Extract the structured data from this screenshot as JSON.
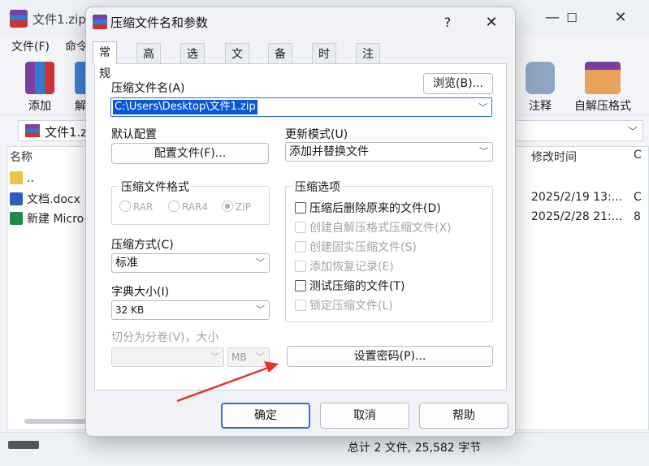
{
  "background": {
    "window_title": "文件1.zip",
    "menus": [
      "文件(F)",
      "命令"
    ],
    "toolbar": [
      {
        "label": "添加",
        "icon": "winrar-books-icon"
      },
      {
        "label": "解",
        "icon": "extract-icon"
      },
      {
        "label": "注释",
        "icon": "comment-icon"
      },
      {
        "label": "自解压格式",
        "icon": "sfx-box-icon"
      }
    ],
    "address": "文件1.zi",
    "columns": {
      "name": "名称",
      "modified": "修改时间",
      "c": "C"
    },
    "rows": [
      {
        "name": "..",
        "modified": "",
        "c": ""
      },
      {
        "name": "文档.docx",
        "modified": "2025/2/19 13:...",
        "c": "C"
      },
      {
        "name": "新建 Micro",
        "modified": "2025/2/28 21:...",
        "c": "8"
      }
    ],
    "status": "总计 2 文件, 25,582 字节"
  },
  "dialog": {
    "title": "压缩文件名和参数",
    "help": "?",
    "close": "✕",
    "tabs": [
      "常规",
      "高级",
      "选项",
      "文件",
      "备份",
      "时间",
      "注释"
    ],
    "archive_name_label": "压缩文件名(A)",
    "browse_button": "浏览(B)...",
    "archive_path": "C:\\Users\\Desktop\\文件1.zip",
    "default_profile_label": "默认配置",
    "profile_button": "配置文件(F)...",
    "update_mode_label": "更新模式(U)",
    "update_mode_value": "添加并替换文件",
    "format_group_title": "压缩文件格式",
    "formats": [
      "RAR",
      "RAR4",
      "ZIP"
    ],
    "selected_format": "ZIP",
    "options_group_title": "压缩选项",
    "options": [
      {
        "label": "压缩后删除原来的文件(D)",
        "enabled": true
      },
      {
        "label": "创建自解压格式压缩文件(X)",
        "enabled": false
      },
      {
        "label": "创建固实压缩文件(S)",
        "enabled": false
      },
      {
        "label": "添加恢复记录(E)",
        "enabled": false
      },
      {
        "label": "测试压缩的文件(T)",
        "enabled": true
      },
      {
        "label": "锁定压缩文件(L)",
        "enabled": false
      }
    ],
    "method_label": "压缩方式(C)",
    "method_value": "标准",
    "dict_label": "字典大小(I)",
    "dict_value": "32 KB",
    "split_label": "切分为分卷(V)，大小",
    "split_unit": "MB",
    "password_button": "设置密码(P)...",
    "ok_button": "确定",
    "cancel_button": "取消",
    "help_button": "帮助"
  },
  "colors": {
    "accent": "#2f6fd6",
    "selection": "#0a57d8",
    "annotation_arrow": "#e0332b"
  }
}
